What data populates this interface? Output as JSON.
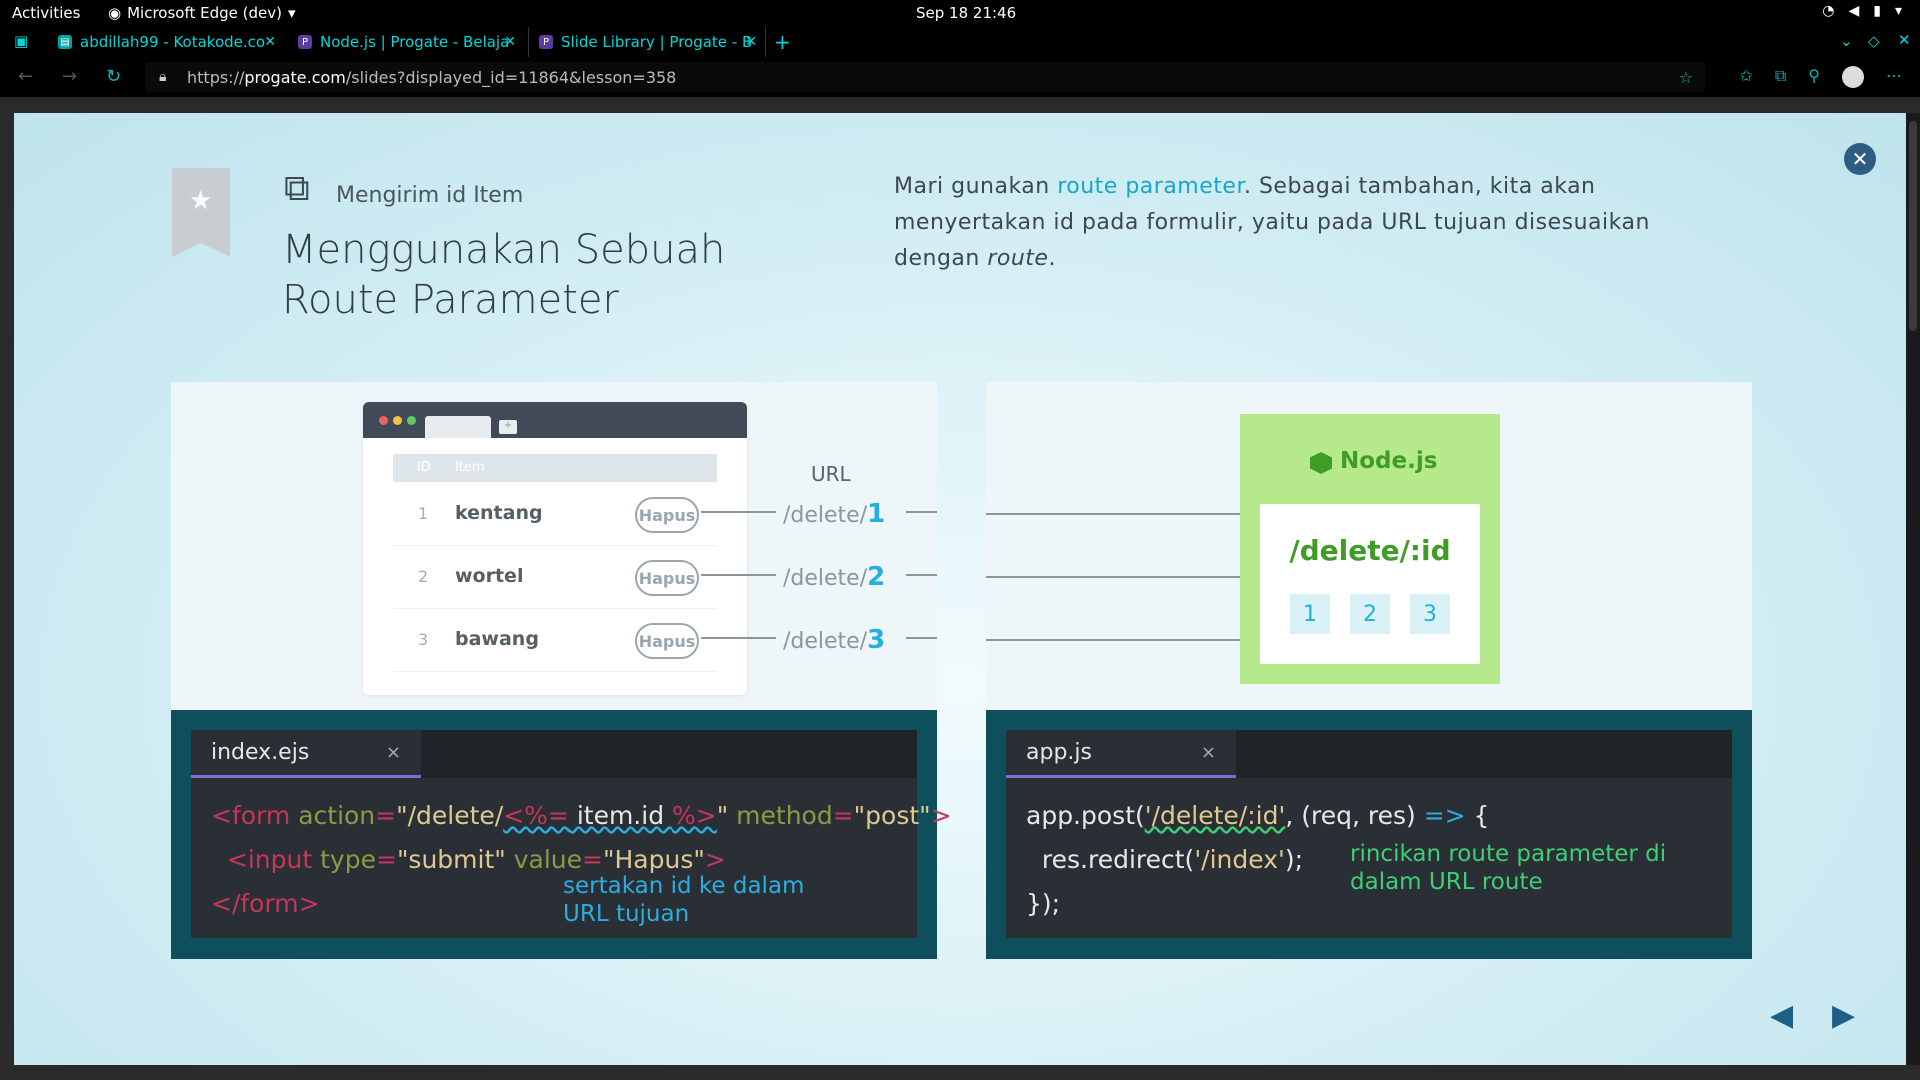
{
  "system": {
    "activities": "Activities",
    "app_name": "Microsoft Edge (dev)",
    "clock": "Sep 18  21:46"
  },
  "tabs": [
    {
      "title": "abdillah99 - Kotakode.co",
      "fav_color": "#00a3a3"
    },
    {
      "title": "Node.js | Progate - Belaja",
      "fav_color": "#5c3b9e"
    },
    {
      "title": "Slide Library | Progate - B",
      "fav_color": "#5c3b9e"
    }
  ],
  "address": {
    "scheme": "https://",
    "host": "progate.com",
    "path": "/slides?displayed_id=11864&lesson=358"
  },
  "slide": {
    "subtitle": "Mengirim id Item",
    "title": "Menggunakan Sebuah Route Parameter",
    "desc_pre": "Mari gunakan ",
    "desc_hl": "route parameter",
    "desc_post": ". Sebagai tambahan, kita akan menyertakan id pada formulir, yaitu pada URL tujuan disesuaikan dengan ",
    "desc_italic": "route",
    "desc_end": "."
  },
  "left_diagram": {
    "table_headers": [
      "ID",
      "Item"
    ],
    "rows": [
      {
        "id": "1",
        "item": "kentang",
        "button": "Hapus",
        "url_prefix": "/delete/",
        "url_id": "1"
      },
      {
        "id": "2",
        "item": "wortel",
        "button": "Hapus",
        "url_prefix": "/delete/",
        "url_id": "2"
      },
      {
        "id": "3",
        "item": "bawang",
        "button": "Hapus",
        "url_prefix": "/delete/",
        "url_id": "3"
      }
    ],
    "url_label": "URL"
  },
  "right_diagram": {
    "brand": "Node.js",
    "route": "/delete/:id",
    "ids": [
      "1",
      "2",
      "3"
    ]
  },
  "left_code": {
    "filename": "index.ejs",
    "close": "×",
    "note": [
      "sertakan id ke dalam",
      "URL tujuan"
    ],
    "note_color": "#2aaee0"
  },
  "right_code": {
    "filename": "app.js",
    "close": "×",
    "note": [
      "rincikan route parameter di",
      "dalam URL route"
    ],
    "note_color": "#3ecf75"
  }
}
